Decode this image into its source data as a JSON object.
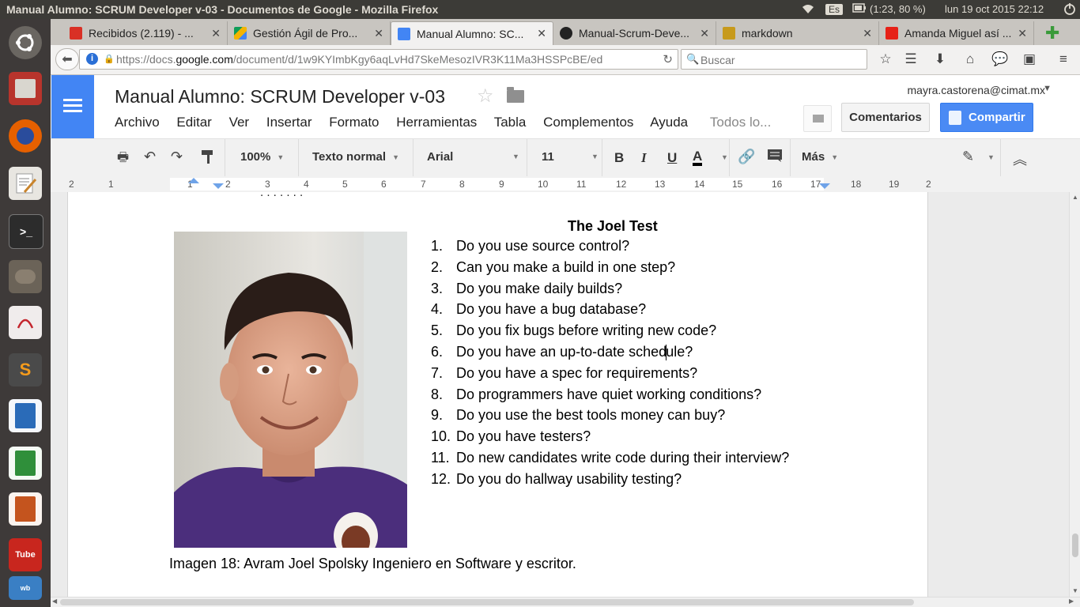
{
  "window_title": "Manual Alumno: SCRUM Developer v-03 - Documentos de Google - Mozilla Firefox",
  "tray": {
    "keyboard_layout": "Es",
    "battery": "(1:23, 80 %)",
    "datetime": "lun 19 oct 2015 22:12"
  },
  "tabs": [
    {
      "label": "Recibidos (2.119) - ...",
      "icon": "gmail-icon",
      "color": "#d93025",
      "active": false
    },
    {
      "label": "Gestión Ágil de Pro...",
      "icon": "drive-icon",
      "color": "#f4b400",
      "active": false
    },
    {
      "label": "Manual Alumno: SC...",
      "icon": "docs-icon",
      "color": "#4285f4",
      "active": true
    },
    {
      "label": "Manual-Scrum-Deve...",
      "icon": "github-icon",
      "color": "#222222",
      "active": false
    },
    {
      "label": "markdown",
      "icon": "pencil-icon",
      "color": "#c79a1c",
      "active": false
    },
    {
      "label": "Amanda Miguel así ...",
      "icon": "youtube-icon",
      "color": "#e62117",
      "active": false
    }
  ],
  "address_bar": {
    "url_prefix": "https://docs.",
    "url_domain": "google.com",
    "url_rest": "/document/d/1w9KYImbKgy6aqLvHd7SkeMesozIVR3K11Ma3HSSPcBE/ed"
  },
  "search": {
    "placeholder": "Buscar"
  },
  "docs": {
    "title": "Manual Alumno: SCRUM Developer v-03",
    "user_email": "mayra.castorena@cimat.mx",
    "menu": [
      "Archivo",
      "Editar",
      "Ver",
      "Insertar",
      "Formato",
      "Herramientas",
      "Tabla",
      "Complementos",
      "Ayuda"
    ],
    "menu_status": "Todos lo...",
    "comments_label": "Comentarios",
    "share_label": "Compartir"
  },
  "toolbar": {
    "zoom": "100%",
    "style": "Texto normal",
    "font": "Arial",
    "size": "11",
    "bold": "B",
    "italic": "I",
    "underline": "U",
    "text_color": "A",
    "more": "Más"
  },
  "ruler": {
    "numbers": [
      "2",
      "1",
      "1",
      "2",
      "3",
      "4",
      "5",
      "6",
      "7",
      "8",
      "9",
      "10",
      "11",
      "12",
      "13",
      "14",
      "15",
      "16",
      "17",
      "18",
      "19",
      "2"
    ]
  },
  "document": {
    "heading": "The Joel Test",
    "questions": [
      {
        "num": "1.",
        "text": "Do you use source control?"
      },
      {
        "num": "2.",
        "text": "Can you make a build in one step?"
      },
      {
        "num": "3.",
        "text": "Do you make daily builds?"
      },
      {
        "num": "4.",
        "text": "Do you have a bug database?"
      },
      {
        "num": "5.",
        "text": "Do you fix bugs before writing new code?"
      },
      {
        "num": "6.",
        "text": "Do you have an up-to-date schedule?"
      },
      {
        "num": "7.",
        "text": "Do you have a spec for requirements?"
      },
      {
        "num": "8.",
        "text": "Do programmers have quiet working conditions?"
      },
      {
        "num": "9.",
        "text": "Do you use the best tools money can buy?"
      },
      {
        "num": "10.",
        "text": "Do you have testers?"
      },
      {
        "num": "11.",
        "text": "Do new candidates write code during their interview?"
      },
      {
        "num": "12.",
        "text": "Do you do hallway usability testing?"
      }
    ],
    "caption": "Imagen 18: Avram Joel Spolsky Ingeniero en Software y escritor."
  },
  "colors": {
    "docs_blue": "#4285f4",
    "share_blue": "#4a8af4",
    "launcher_bg": "#3e3a39",
    "topbar_bg": "#3c3b37"
  }
}
